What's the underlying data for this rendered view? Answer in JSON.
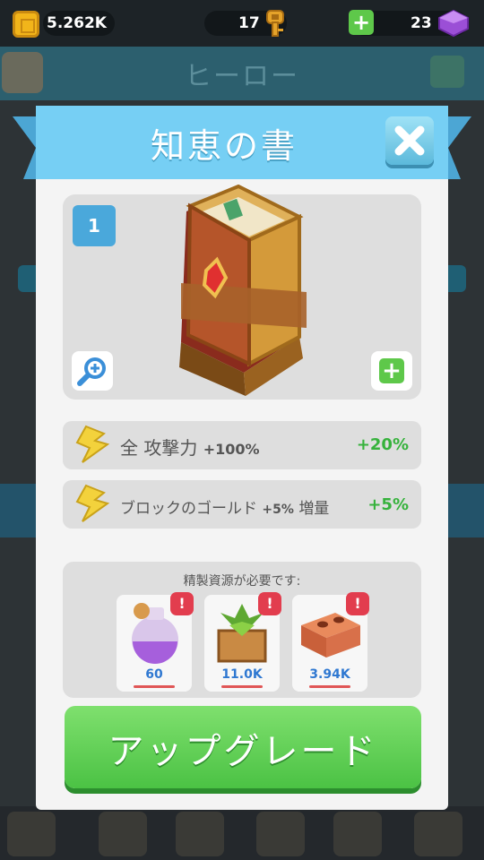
{
  "hud": {
    "gold": "5.262K",
    "keys": "17",
    "gems": "23"
  },
  "background": {
    "screen_title": "ヒーロー"
  },
  "modal": {
    "title": "知恵の書",
    "item_level": "1",
    "stats": [
      {
        "label": "全 攻撃力",
        "value": "+100%",
        "bonus": "+20%"
      },
      {
        "label": "ブロックのゴールド",
        "value": "+5%",
        "suffix": "増量",
        "bonus": "+5%"
      }
    ],
    "resources_title": "精製資源が必要です:",
    "resources": [
      {
        "name": "potion",
        "amount": "60",
        "alert": "!"
      },
      {
        "name": "plant-crate",
        "amount": "11.0K",
        "alert": "!"
      },
      {
        "name": "brick",
        "amount": "3.94K",
        "alert": "!"
      }
    ],
    "upgrade_label": "アップグレード"
  },
  "colors": {
    "header": "#76cff4",
    "upgrade": "#4bc244",
    "bonus": "#36b23c",
    "resource_value": "#2f78d1",
    "alert": "#e23d4e"
  },
  "icons": [
    "gold-coin-icon",
    "key-icon",
    "add-gems-icon",
    "gem-icon",
    "gear-icon",
    "close-icon",
    "zoom-icon",
    "plus-icon",
    "lightning-icon",
    "book-of-wisdom-icon"
  ]
}
